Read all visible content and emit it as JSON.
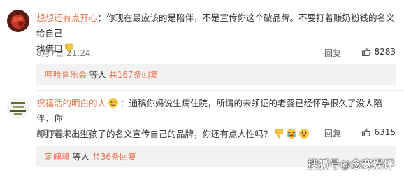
{
  "comments": [
    {
      "username": "想想还有点开心",
      "text_line1": "：你现在最应该的是陪伴，不是宣传你这个破品牌。不要打着赚奶粉钱的名义给自己",
      "text_line2": "找借口",
      "emojis": [
        "thumbs-down-icon"
      ],
      "time": "8月7日 21:24",
      "reply_label": "回复",
      "likes": "8283",
      "reply_summary": {
        "replier": "哼哈喜乐会",
        "others": "等人",
        "count_text": "共167条回复"
      }
    },
    {
      "username": "祝福活的明白的人",
      "text_line1": "：通稿你妈说生病住院，所谓的未领证的老婆已经怀孕很久了没人陪伴，你",
      "text_line2": "却打着未出生孩子的名义宣传自己的品牌，你还有点人性吗？",
      "emojis": [
        "thumbs-down-icon",
        "crying-face-icon",
        "worried-face-icon"
      ],
      "time": "8月7日 21:29",
      "reply_label": "回复",
      "likes": "6315",
      "reply_summary": {
        "replier": "定魄魂",
        "others": "等人",
        "count_text": "共36条回复"
      }
    }
  ],
  "watermark": "搜狐号@念寒娱评"
}
